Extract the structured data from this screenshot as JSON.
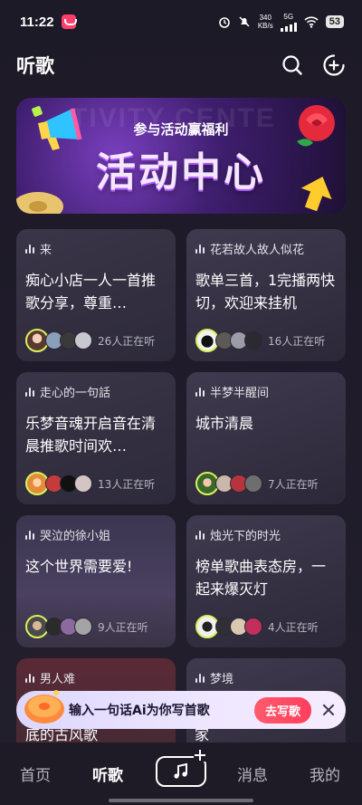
{
  "status_bar": {
    "time": "11:22",
    "net_speed_value": "340",
    "net_speed_unit": "KB/s",
    "network": "5G",
    "battery": "53"
  },
  "header": {
    "title": "听歌",
    "search_icon": "search-icon",
    "add_icon": "add-circle-icon"
  },
  "banner": {
    "watermark": "TIVITY CENTE",
    "subtitle": "参与活动赢福利",
    "title": "活动中心"
  },
  "rooms": [
    {
      "host": "来",
      "title": "痴心小店一人一首推歌分享，尊重…",
      "listeners": "26人正在听"
    },
    {
      "host": "花若故人故人似花",
      "title": "歌单三首，1完播两快切，欢迎来挂机",
      "listeners": "16人正在听"
    },
    {
      "host": "走心的一句話",
      "title": "乐梦音魂开启音在清晨推歌时间欢…",
      "listeners": "13人正在听"
    },
    {
      "host": "半梦半醒间",
      "title": "城市清晨",
      "listeners": "7人正在听"
    },
    {
      "host": "哭泣的徐小姐",
      "title": "这个世界需要爱!",
      "listeners": "9人正在听"
    },
    {
      "host": "烛光下的时光",
      "title": "榜单歌曲表态房，一起来爆灭灯",
      "listeners": "4人正在听"
    },
    {
      "host": "男人难",
      "title": "",
      "listeners": ""
    },
    {
      "host": "梦境",
      "title": "",
      "listeners": ""
    }
  ],
  "peek": {
    "left": "底的古风歌",
    "right": "家"
  },
  "ai_prompt": {
    "text": "输入一句话Ai为你写首歌",
    "button": "去写歌"
  },
  "nav": {
    "home": "首页",
    "listen": "听歌",
    "messages": "消息",
    "me": "我的"
  },
  "colors": {
    "accent": "#ff3f5c",
    "avatar_ring": "#d9f25c",
    "card": "#34303f"
  }
}
